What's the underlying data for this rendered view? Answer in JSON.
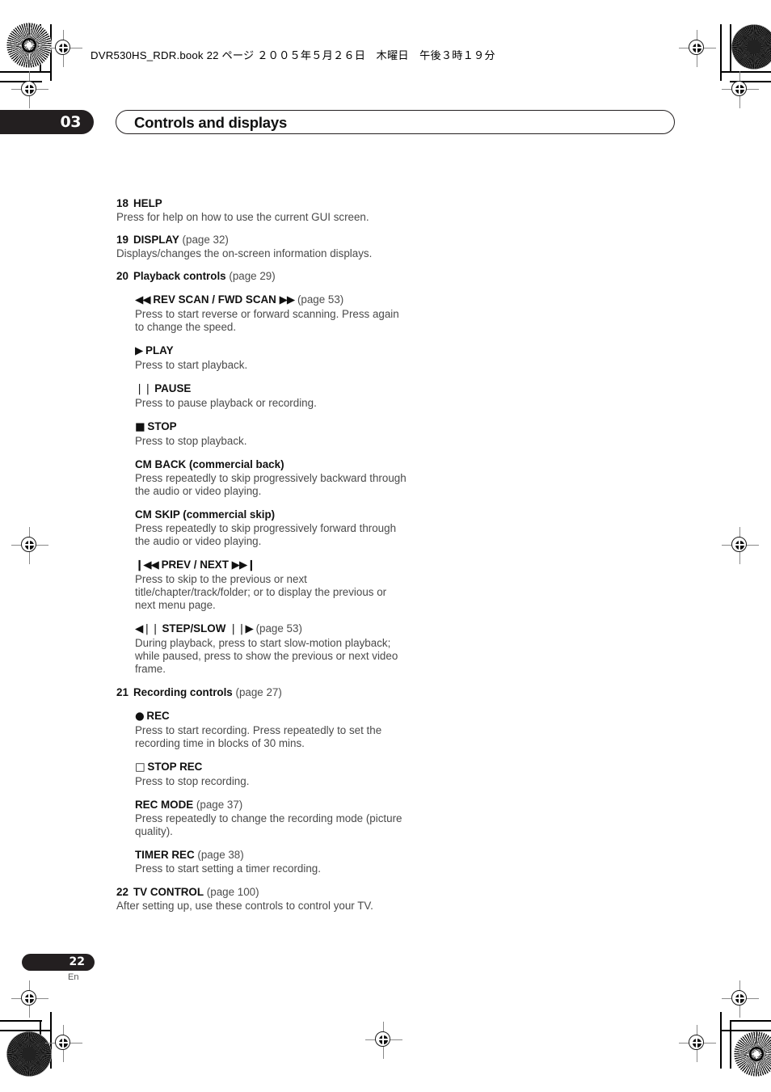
{
  "print_header": {
    "book_line": "DVR530HS_RDR.book  22 ページ  ２００５年５月２６日　木曜日　午後３時１９分"
  },
  "chapter": {
    "number": "03",
    "title": "Controls and displays"
  },
  "footer": {
    "page_number": "22",
    "language_code": "En"
  },
  "entries": [
    {
      "num": "18",
      "label": "HELP",
      "page_ref": "",
      "body": "Press for help on how to use the current GUI screen.",
      "subs": []
    },
    {
      "num": "19",
      "label": "DISPLAY",
      "page_ref": "(page 32)",
      "body": "Displays/changes the on-screen information displays.",
      "subs": []
    },
    {
      "num": "20",
      "label": "Playback controls",
      "page_ref": "(page 29)",
      "body": "",
      "subs": [
        {
          "icon_before": "◀◀",
          "label": "REV SCAN / FWD SCAN",
          "icon_after": "▶▶",
          "page_ref": "(page 53)",
          "body": "Press to start reverse or forward scanning. Press again to change the speed."
        },
        {
          "icon_before": "▶",
          "label": "PLAY",
          "icon_after": "",
          "page_ref": "",
          "body": "Press to start playback."
        },
        {
          "icon_before": "❘❘",
          "label": "PAUSE",
          "icon_after": "",
          "page_ref": "",
          "body": "Press to pause playback or recording."
        },
        {
          "icon_before": "■",
          "label": "STOP",
          "icon_after": "",
          "page_ref": "",
          "body": "Press to stop playback."
        },
        {
          "icon_before": "",
          "label": "CM BACK (commercial back)",
          "icon_after": "",
          "page_ref": "",
          "body": "Press repeatedly to skip progressively backward through the audio or video playing."
        },
        {
          "icon_before": "",
          "label": "CM SKIP (commercial skip)",
          "icon_after": "",
          "page_ref": "",
          "body": "Press repeatedly to skip progressively forward through the audio or video playing."
        },
        {
          "icon_before": "❙◀◀",
          "label": "PREV / NEXT",
          "icon_after": "▶▶❙",
          "page_ref": "",
          "body": "Press to skip to the previous or next title/chapter/track/folder; or to display the previous or next menu page."
        },
        {
          "icon_before": "◀❘❘",
          "label": "STEP/SLOW",
          "icon_after": "❘❘▶",
          "page_ref": "(page 53)",
          "body": "During playback, press to start slow-motion playback; while paused, press to show the previous or next video frame."
        }
      ]
    },
    {
      "num": "21",
      "label": "Recording controls",
      "page_ref": "(page 27)",
      "body": "",
      "subs": [
        {
          "icon_before": "●",
          "label": "REC",
          "icon_after": "",
          "page_ref": "",
          "body": "Press to start recording. Press repeatedly to set the recording time in blocks of 30 mins."
        },
        {
          "icon_before": "□",
          "label": "STOP REC",
          "icon_after": "",
          "page_ref": "",
          "body": "Press to stop recording."
        },
        {
          "icon_before": "",
          "label": "REC MODE",
          "icon_after": "",
          "page_ref": "(page 37)",
          "body": "Press repeatedly to change the recording mode (picture quality)."
        },
        {
          "icon_before": "",
          "label": "TIMER REC",
          "icon_after": "",
          "page_ref": "(page 38)",
          "body": "Press to start setting a timer recording."
        }
      ]
    },
    {
      "num": "22",
      "label": "TV CONTROL",
      "page_ref": "(page 100)",
      "body": "After setting up, use these controls to control your TV.",
      "subs": []
    }
  ],
  "colors": {
    "ink_black": "#231f20",
    "body_gray": "#4a4a4a",
    "paper": "#ffffff"
  }
}
